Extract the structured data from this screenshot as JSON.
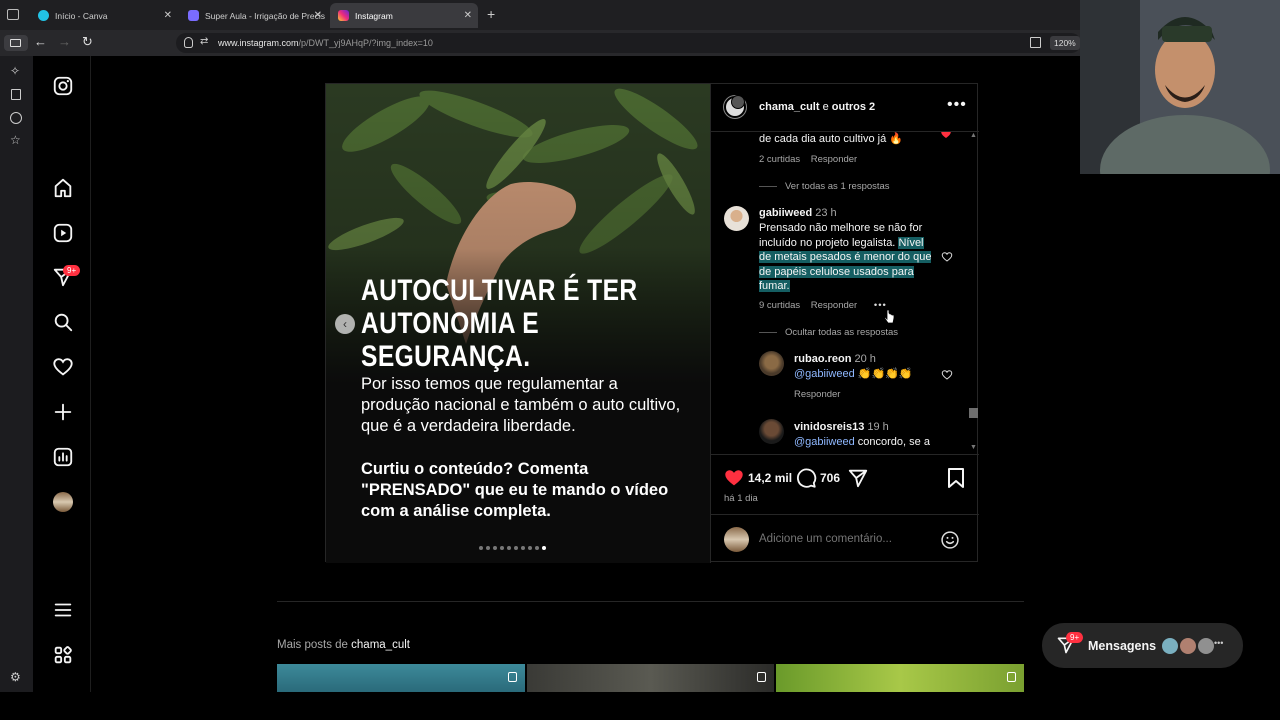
{
  "browser": {
    "tabs": [
      {
        "label": "Início - Canva",
        "color": "#22c3e6",
        "active": false
      },
      {
        "label": "Super Aula - Irrigação de Precis",
        "color": "#7a6cff",
        "active": false
      },
      {
        "label": "Instagram",
        "color": "#e1306c",
        "active": true
      }
    ],
    "url_host": "www.instagram.com",
    "url_path": "/p/DWT_yj9AHqP/?img_index=10",
    "zoom": "120%"
  },
  "nav": {
    "notif_badge": "9+"
  },
  "post": {
    "headline_line1": "AUTOCULTIVAR É TER",
    "headline_line2": "AUTONOMIA E SEGURANÇA.",
    "body": "Por isso temos que regulamentar a produção nacional e também o auto cultivo, que é a verdadeira liberdade.",
    "cta": "Curtiu o conteúdo? Comenta \"PRENSADO\" que eu te mando o vídeo com a análise completa.",
    "carousel_total": 10,
    "carousel_index": 10,
    "author": "chama_cult",
    "coauthors": "e",
    "others": "outros 2"
  },
  "comments": {
    "top_fragment": "de cada dia auto cultivo já 🔥",
    "top_likes": "2 curtidas",
    "reply_label": "Responder",
    "view_replies": "Ver todas as 1 respostas",
    "c1_user": "gabiiweed",
    "c1_time": "23 h",
    "c1_text_plain": "Prensado não melhore se não for incluído no projeto legalista.",
    "c1_text_highlight": "Nível de metais pesados é menor do que de papéis celulose usados para fumar.",
    "c1_likes": "9 curtidas",
    "hide_replies": "Ocultar todas as respostas",
    "r1_user": "rubao.reon",
    "r1_time": "20 h",
    "r1_mention": "@gabiiweed",
    "r1_text": "👏👏👏👏",
    "r2_user": "vinidosreis13",
    "r2_time": "19 h",
    "r2_mention": "@gabiiweed",
    "r2_text": "concordo, se a"
  },
  "actions": {
    "likes": "14,2 mil",
    "comments": "706",
    "age": "há 1 dia",
    "comment_placeholder": "Adicione um comentário..."
  },
  "more_posts": {
    "prefix": "Mais posts de",
    "user": "chama_cult"
  },
  "messages": {
    "label": "Mensagens",
    "badge": "9+"
  },
  "colors": {
    "like_red": "#ff3040",
    "highlight": "#155e62",
    "badge_red": "#ff3040"
  }
}
